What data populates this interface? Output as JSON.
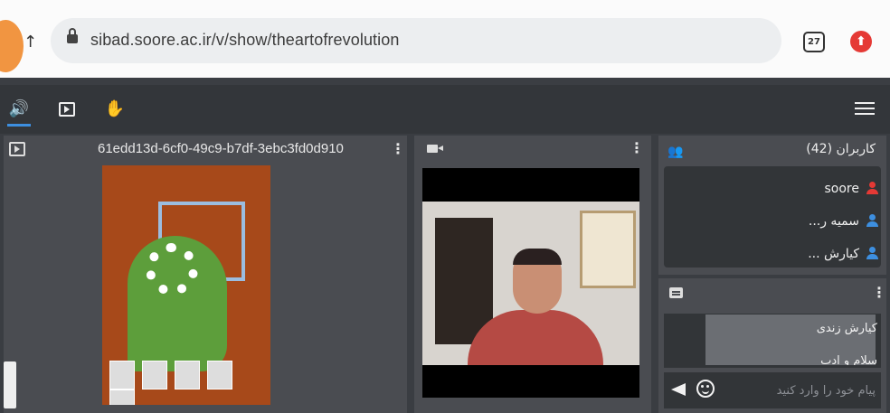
{
  "browser": {
    "back_label": "↑",
    "url": "sibad.soore.ac.ir/v/show/theartofrevolution",
    "tab_count": "27",
    "update_icon": "arrow-up-icon"
  },
  "toolbar": {
    "audio_icon": "speaker-icon",
    "media_icon": "play-icon",
    "hand_icon": "raise-hand-icon",
    "menu_icon": "hamburger-menu-icon"
  },
  "presentation": {
    "title": "61edd13d-6cf0-49c9-b7df-3ebc3fd0d910",
    "kebab": "⋮"
  },
  "video": {
    "kebab": "⋮"
  },
  "users": {
    "title": "کاربران (42)",
    "list": [
      {
        "name": "soore",
        "color": "#e53935"
      },
      {
        "name": "سمیه ر...",
        "color": "#3d8fe0"
      },
      {
        "name": "کیارش ...",
        "color": "#3d8fe0"
      }
    ]
  },
  "chat": {
    "kebab": "⋮",
    "message_name": "کیارش زندی",
    "message_text": "سلام و ادب",
    "input_placeholder": "پیام خود را وارد کنید"
  },
  "colors": {
    "accent": "#3d8fe0",
    "owner": "#e53935",
    "panel": "#4a4c51"
  }
}
